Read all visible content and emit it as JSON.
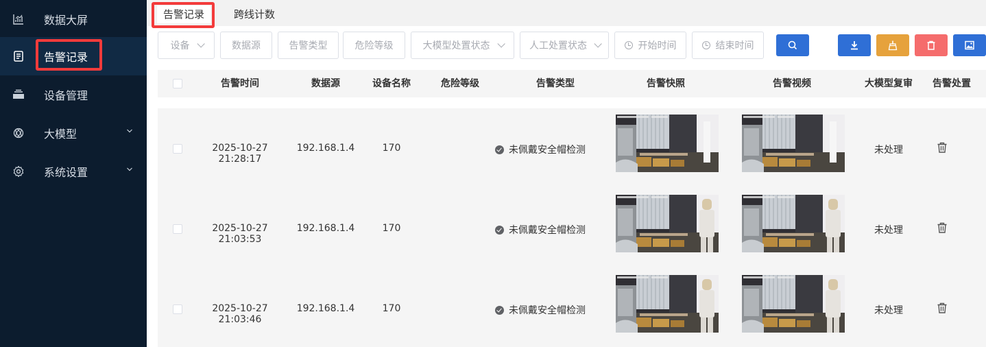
{
  "sidebar": {
    "items": [
      {
        "label": "数据大屏",
        "icon": "chart-icon"
      },
      {
        "label": "告警记录",
        "icon": "document-icon"
      },
      {
        "label": "设备管理",
        "icon": "device-icon"
      },
      {
        "label": "大模型",
        "icon": "model-icon"
      },
      {
        "label": "系统设置",
        "icon": "gear-icon"
      }
    ]
  },
  "tabs": [
    {
      "label": "告警记录"
    },
    {
      "label": "跨线计数"
    }
  ],
  "filters": {
    "device": "设备",
    "source": "数据源",
    "alarm_type": "告警类型",
    "danger_level": "危险等级",
    "model_status": "大模型处置状态",
    "manual_status": "人工处置状态",
    "start_time": "开始时间",
    "end_time": "结束时间"
  },
  "buttons": {
    "search_icon": "search-icon",
    "download_icon": "download-icon",
    "clean_icon": "broom-icon",
    "delete_icon": "trash-icon",
    "image_icon": "image-icon"
  },
  "colors": {
    "sidebar_bg": "#0c1c2e",
    "primary": "#2f6fd6",
    "warning": "#e6a23c",
    "danger": "#f56c6c",
    "highlight_box": "#f33b3b"
  },
  "table": {
    "headers": [
      "告警时间",
      "数据源",
      "设备名称",
      "危险等级",
      "告警类型",
      "告警快照",
      "告警视频",
      "大模型复审",
      "告警处置"
    ],
    "rows": [
      {
        "time": "2025-10-27 21:28:17",
        "source": "192.168.1.4",
        "device": "170",
        "level": "",
        "type": "未佩戴安全帽检测",
        "review": "未处理"
      },
      {
        "time": "2025-10-27 21:03:53",
        "source": "192.168.1.4",
        "device": "170",
        "level": "",
        "type": "未佩戴安全帽检测",
        "review": "未处理"
      },
      {
        "time": "2025-10-27 21:03:46",
        "source": "192.168.1.4",
        "device": "170",
        "level": "",
        "type": "未佩戴安全帽检测",
        "review": "未处理"
      }
    ]
  }
}
